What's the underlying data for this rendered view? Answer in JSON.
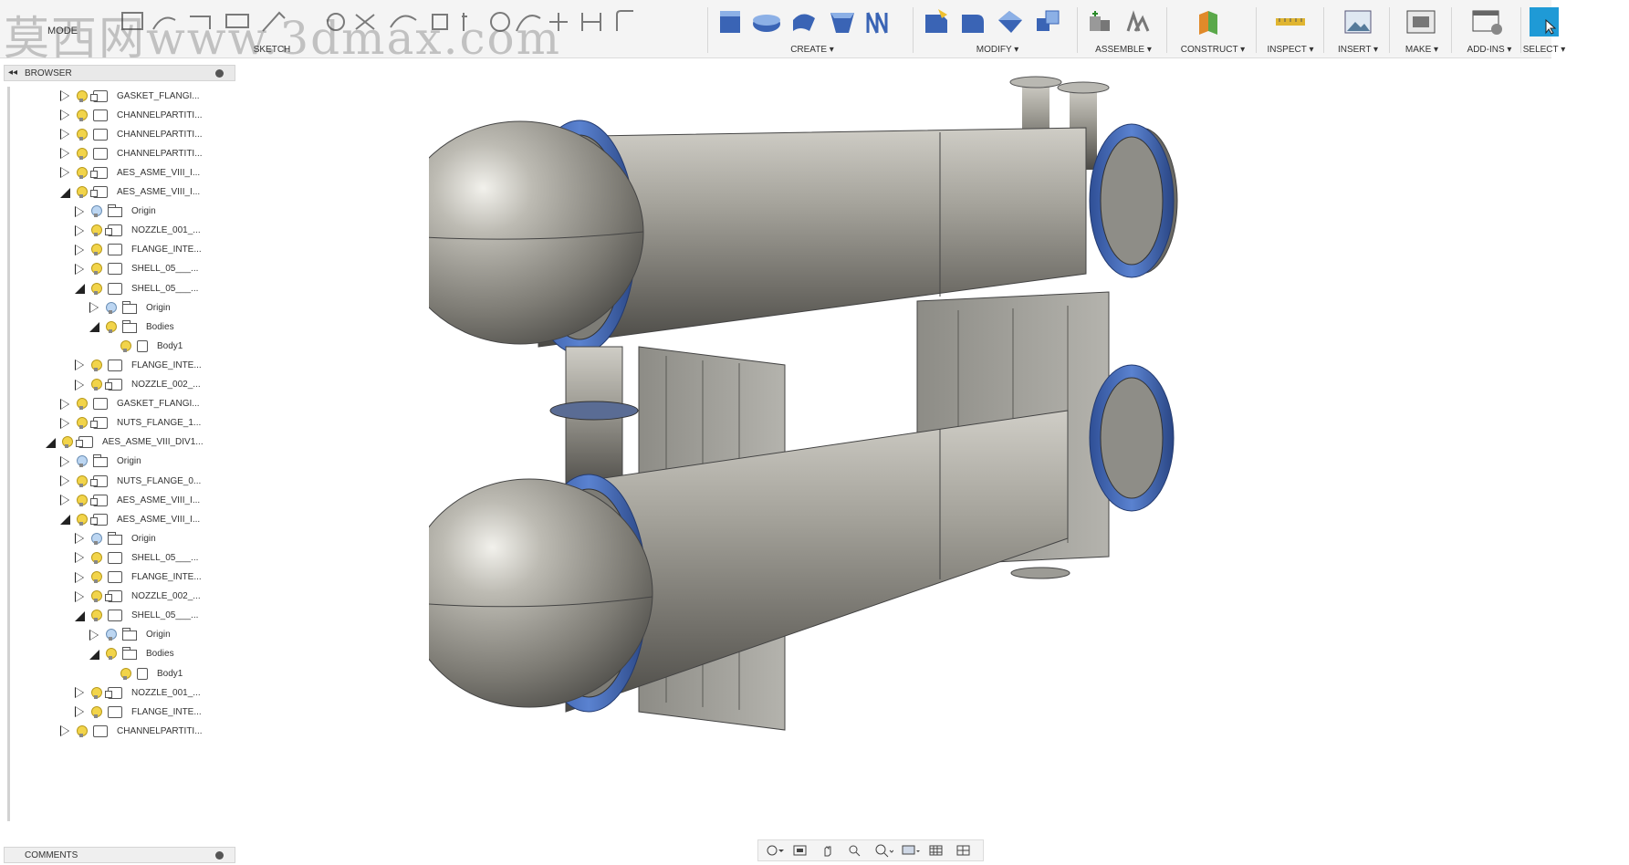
{
  "toolbar": {
    "mode_label": "MODE",
    "sketch_label": "SKETCH",
    "groups": {
      "create": "CREATE ▾",
      "modify": "MODIFY ▾",
      "assemble": "ASSEMBLE ▾",
      "construct": "CONSTRUCT ▾",
      "inspect": "INSPECT ▾",
      "insert": "INSERT ▾",
      "make": "MAKE ▾",
      "addins": "ADD-INS ▾",
      "select": "SELECT ▾"
    }
  },
  "watermark": "莫西网www.3dmax.com",
  "browser": {
    "title": "BROWSER",
    "rows": [
      {
        "label": "GASKET_FLANGI...",
        "icon": "component",
        "bulb": "yellow",
        "expanded": false
      },
      {
        "label": "CHANNELPARTITI...",
        "icon": "body",
        "bulb": "yellow",
        "expanded": false
      },
      {
        "label": "CHANNELPARTITI...",
        "icon": "body",
        "bulb": "yellow",
        "expanded": false
      },
      {
        "label": "CHANNELPARTITI...",
        "icon": "body",
        "bulb": "yellow",
        "expanded": false
      },
      {
        "label": "AES_ASME_VIII_I...",
        "icon": "component",
        "bulb": "yellow",
        "expanded": false
      },
      {
        "label": "AES_ASME_VIII_I...",
        "icon": "component",
        "bulb": "yellow",
        "expanded": true
      },
      {
        "label": "Origin",
        "icon": "folder",
        "bulb": "blue",
        "expanded": false
      },
      {
        "label": "NOZZLE_001_...",
        "icon": "component",
        "bulb": "yellow",
        "expanded": false
      },
      {
        "label": "FLANGE_INTE...",
        "icon": "body",
        "bulb": "yellow",
        "expanded": false
      },
      {
        "label": "SHELL_05___...",
        "icon": "body",
        "bulb": "yellow",
        "expanded": false
      },
      {
        "label": "SHELL_05___...",
        "icon": "body",
        "bulb": "yellow",
        "expanded": true
      },
      {
        "label": "Origin",
        "icon": "folder",
        "bulb": "blue",
        "expanded": false
      },
      {
        "label": "Bodies",
        "icon": "folder",
        "bulb": "yellow",
        "expanded": true
      },
      {
        "label": "Body1",
        "icon": "solid",
        "bulb": "yellow",
        "expanded": null
      },
      {
        "label": "FLANGE_INTE...",
        "icon": "body",
        "bulb": "yellow",
        "expanded": false
      },
      {
        "label": "NOZZLE_002_...",
        "icon": "component",
        "bulb": "yellow",
        "expanded": false
      },
      {
        "label": "GASKET_FLANGI...",
        "icon": "body",
        "bulb": "yellow",
        "expanded": false
      },
      {
        "label": "NUTS_FLANGE_1...",
        "icon": "component",
        "bulb": "yellow",
        "expanded": false
      },
      {
        "label": "AES_ASME_VIII_DIV1...",
        "icon": "component",
        "bulb": "yellow",
        "expanded": true
      },
      {
        "label": "Origin",
        "icon": "folder",
        "bulb": "blue",
        "expanded": false
      },
      {
        "label": "NUTS_FLANGE_0...",
        "icon": "component",
        "bulb": "yellow",
        "expanded": false
      },
      {
        "label": "AES_ASME_VIII_I...",
        "icon": "component",
        "bulb": "yellow",
        "expanded": false
      },
      {
        "label": "AES_ASME_VIII_I...",
        "icon": "component",
        "bulb": "yellow",
        "expanded": true
      },
      {
        "label": "Origin",
        "icon": "folder",
        "bulb": "blue",
        "expanded": false
      },
      {
        "label": "SHELL_05___...",
        "icon": "body",
        "bulb": "yellow",
        "expanded": false
      },
      {
        "label": "FLANGE_INTE...",
        "icon": "body",
        "bulb": "yellow",
        "expanded": false
      },
      {
        "label": "NOZZLE_002_...",
        "icon": "component",
        "bulb": "yellow",
        "expanded": false
      },
      {
        "label": "SHELL_05___...",
        "icon": "body",
        "bulb": "yellow",
        "expanded": true
      },
      {
        "label": "Origin",
        "icon": "folder",
        "bulb": "blue",
        "expanded": false
      },
      {
        "label": "Bodies",
        "icon": "folder",
        "bulb": "yellow",
        "expanded": true
      },
      {
        "label": "Body1",
        "icon": "solid",
        "bulb": "yellow",
        "expanded": null
      },
      {
        "label": "NOZZLE_001_...",
        "icon": "component",
        "bulb": "yellow",
        "expanded": false
      },
      {
        "label": "FLANGE_INTE...",
        "icon": "body",
        "bulb": "yellow",
        "expanded": false
      },
      {
        "label": "CHANNELPARTITI...",
        "icon": "body",
        "bulb": "yellow",
        "expanded": false
      }
    ]
  },
  "comments": {
    "title": "COMMENTS"
  },
  "navbar": {
    "icons": [
      "orbit-icon",
      "look-at-icon",
      "pan-icon",
      "zoom-icon",
      "zoom-window-icon",
      "display-settings-icon",
      "grid-icon",
      "viewports-icon"
    ]
  },
  "colors": {
    "accent_select": "#1f9ad6",
    "flange_blue": "#3b5fa8",
    "steel": "#9a9890"
  }
}
